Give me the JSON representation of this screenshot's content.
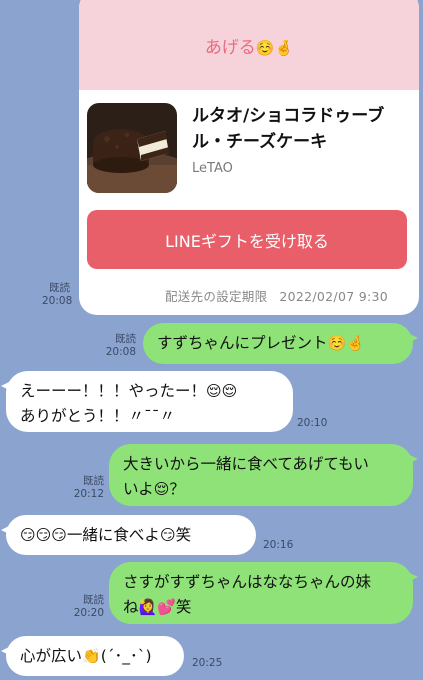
{
  "gift": {
    "send_text": "あげる",
    "product_name": "ルタオ/ショコラドゥーブル・チーズケーキ",
    "brand": "LeTAO",
    "button_label": "LINEギフトを受け取る",
    "deadline_label": "配送先の設定期限",
    "deadline_value": "2022/02/07 9:30",
    "read": "既読",
    "time": "20:08"
  },
  "messages": [
    {
      "side": "me",
      "text": "すずちゃんにプレゼント",
      "emoji": "☺️🤞",
      "read": "既読",
      "time": "20:08"
    },
    {
      "side": "them",
      "line1": "えーーー！！！やったー！",
      "line1_emoji": "😌😌",
      "line2": "ありがとう！！〃¯¯〃",
      "time": "20:10"
    },
    {
      "side": "me",
      "line1": "大きいから一緒に食べてあげてもい",
      "line2": "いよ",
      "line2_emoji": "😌",
      "line2_tail": "？",
      "read": "既読",
      "time": "20:12"
    },
    {
      "side": "them",
      "lead_emoji": "😏😏😏",
      "text": "一緒に食べよ",
      "emoji": "😏",
      "tail": "笑",
      "time": "20:16"
    },
    {
      "side": "me",
      "line1": "さすがすずちゃんはななちゃんの妹",
      "line2": "ね",
      "line2_emoji": "🙋‍♀️💕",
      "line2_tail": "笑",
      "read": "既読",
      "time": "20:20"
    },
    {
      "side": "them",
      "text": "心が広い",
      "emoji": "👏",
      "tail": "(´･_･`)",
      "time": "20:25"
    }
  ],
  "colors": {
    "background": "#8aa3cf",
    "my_bubble": "#8fe278",
    "their_bubble": "#ffffff",
    "gift_header": "#f6d3da",
    "gift_button": "#e85f69"
  }
}
